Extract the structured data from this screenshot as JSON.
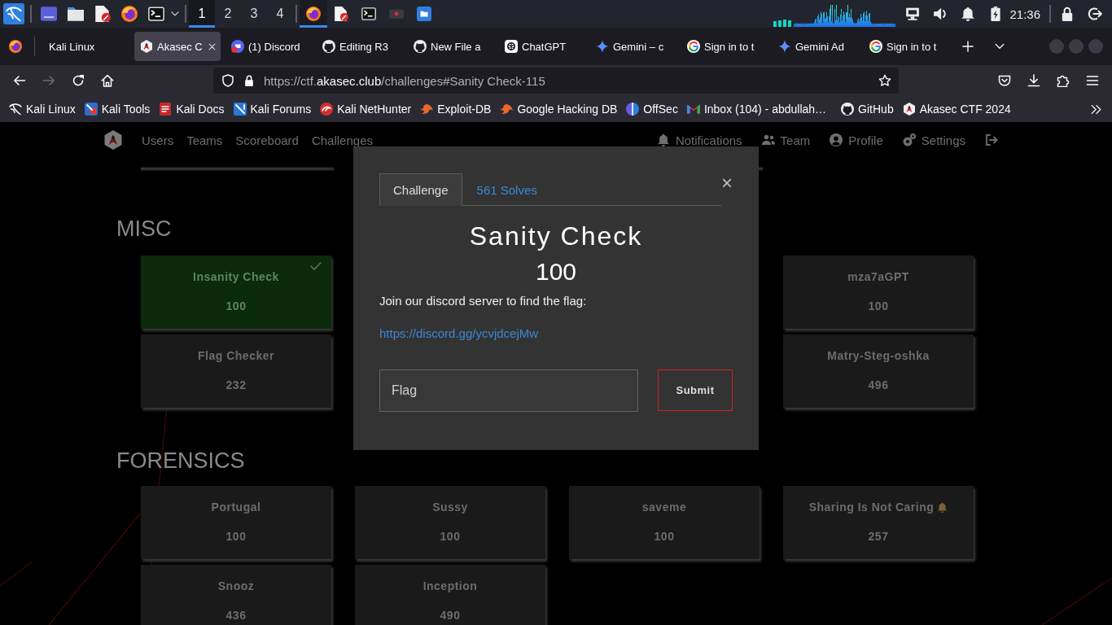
{
  "panel": {
    "launchers": [
      {
        "kind": "desktop"
      },
      {
        "kind": "folder"
      },
      {
        "kind": "editor"
      },
      {
        "kind": "browser"
      },
      {
        "kind": "terminal"
      }
    ],
    "workspaces": [
      {
        "label": "1",
        "selected": true
      },
      {
        "label": "2",
        "selected": false
      },
      {
        "label": "3",
        "selected": false
      },
      {
        "label": "4",
        "selected": false
      }
    ],
    "windows": [
      {
        "kind": "browser",
        "selected": true
      },
      {
        "kind": "editor",
        "selected": false
      },
      {
        "kind": "terminal",
        "selected": false
      },
      {
        "kind": "screen",
        "selected": false
      },
      {
        "kind": "files",
        "selected": false
      }
    ],
    "tray": [
      {
        "kind": "network"
      },
      {
        "kind": "volume"
      },
      {
        "kind": "bell"
      },
      {
        "kind": "battery"
      }
    ],
    "clock": "21:36"
  },
  "browser": {
    "tabs": [
      {
        "label": "Kali Linux",
        "kind": "none",
        "selected": false
      },
      {
        "label": "Akasec C",
        "kind": "triangle",
        "selected": true
      },
      {
        "label": "(1) Discord",
        "kind": "disc",
        "selected": false
      },
      {
        "label": "Editing R3",
        "kind": "cat",
        "selected": false
      },
      {
        "label": "New File a",
        "kind": "cat",
        "selected": false
      },
      {
        "label": "ChatGPT",
        "kind": "knot",
        "selected": false
      },
      {
        "label": "Gemini – c",
        "kind": "sparkle",
        "selected": false
      },
      {
        "label": "Sign in to t",
        "kind": "ring",
        "selected": false
      },
      {
        "label": "Gemini Ad",
        "kind": "sparkle",
        "selected": false
      },
      {
        "label": "Sign in to t",
        "kind": "ring",
        "selected": false
      }
    ],
    "nav": [
      {
        "kind": "back",
        "disabled": false
      },
      {
        "kind": "forward",
        "disabled": true
      },
      {
        "kind": "reload",
        "disabled": false
      },
      {
        "kind": "home",
        "disabled": false
      }
    ],
    "url": {
      "before_domain": "https://ctf.",
      "domain": "akasec.club",
      "after_domain": "/challenges#Sanity Check-115"
    },
    "bookmarks": [
      {
        "label": "Kali Linux",
        "kind": "dragon"
      },
      {
        "label": "Kali Tools",
        "kind": "tools"
      },
      {
        "label": "Kali Docs",
        "kind": "docs"
      },
      {
        "label": "Kali Forums",
        "kind": "forums"
      },
      {
        "label": "Kali NetHunter",
        "kind": "nethunter"
      },
      {
        "label": "Exploit-DB",
        "kind": "bug"
      },
      {
        "label": "Google Hacking DB",
        "kind": "bug"
      },
      {
        "label": "OffSec",
        "kind": "offsec"
      },
      {
        "label": "Inbox (104) - abdullah…",
        "kind": "mail"
      },
      {
        "label": "GitHub",
        "kind": "cat"
      },
      {
        "label": "Akasec CTF 2024",
        "kind": "triangle"
      }
    ]
  },
  "site": {
    "nav_left": [
      "Users",
      "Teams",
      "Scoreboard",
      "Challenges"
    ],
    "nav_right": [
      {
        "label": "Notifications",
        "kind": "bell"
      },
      {
        "label": "Team",
        "kind": "users"
      },
      {
        "label": "Profile",
        "kind": "user"
      },
      {
        "label": "Settings",
        "kind": "gears"
      },
      {
        "kind": "logout"
      }
    ]
  },
  "categories": [
    {
      "name": "MISC",
      "cards": [
        {
          "name": "Insanity Check",
          "value": "100",
          "solved": true,
          "kind": "plain"
        },
        {
          "name": "mza7aGPT",
          "value": "100",
          "solved": false,
          "kind": "plain"
        },
        {
          "name": "Flag Checker",
          "value": "232",
          "solved": false,
          "kind": "plain"
        },
        {
          "name": "Matry-Steg-oshka",
          "value": "496",
          "solved": false,
          "kind": "plain"
        }
      ]
    },
    {
      "name": "FORENSICS",
      "cards": [
        {
          "name": "Portugal",
          "value": "100",
          "solved": false,
          "kind": "plain"
        },
        {
          "name": "Sussy",
          "value": "100",
          "solved": false,
          "kind": "plain"
        },
        {
          "name": "saveme",
          "value": "100",
          "solved": false,
          "kind": "plain"
        },
        {
          "name": "Sharing Is Not Caring",
          "value": "257",
          "solved": false,
          "kind": "emoji"
        },
        {
          "name": "Snooz",
          "value": "436",
          "solved": false,
          "kind": "plain"
        },
        {
          "name": "Inception",
          "value": "490",
          "solved": false,
          "kind": "plain"
        }
      ]
    }
  ],
  "modal": {
    "tabs": [
      {
        "label": "Challenge",
        "selected": true
      },
      {
        "label": "561 Solves",
        "selected": false
      }
    ],
    "close": "×",
    "title": "Sanity Check",
    "value": "100",
    "description": "Join our discord server to find the flag:",
    "link": "https://discord.gg/ycvjdcejMw",
    "flag_input": {
      "placeholder": "Flag"
    },
    "submit": "Submit"
  }
}
